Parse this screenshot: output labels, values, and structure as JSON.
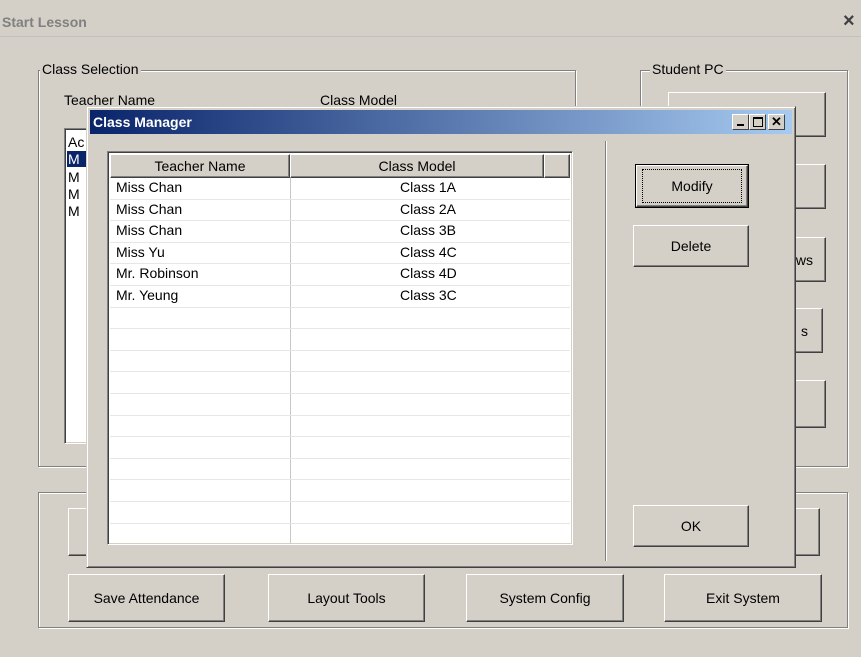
{
  "main_window": {
    "title": "Start Lesson",
    "close_glyph": "×",
    "class_selection": {
      "legend": "Class Selection",
      "col_teacher_partial": "Teacher Name",
      "col_class_partial": "Class Model",
      "list_items_partial": [
        "Ac",
        "M",
        "M",
        "M",
        "M"
      ]
    },
    "student_pc": {
      "legend": "Student PC",
      "partial_labels": [
        "",
        "",
        "ws",
        "s",
        ""
      ]
    },
    "bottom_buttons": [
      {
        "label": "Save Attendance"
      },
      {
        "label": "Layout Tools"
      },
      {
        "label": "System Config"
      },
      {
        "label": "Exit System"
      }
    ]
  },
  "dialog": {
    "title": "Class Manager",
    "columns": [
      "Teacher Name",
      "Class Model"
    ],
    "rows": [
      {
        "teacher": "Miss Chan",
        "class": "Class 1A"
      },
      {
        "teacher": "Miss Chan",
        "class": "Class 2A"
      },
      {
        "teacher": "Miss Chan",
        "class": "Class 3B"
      },
      {
        "teacher": "Miss Yu",
        "class": "Class 4C"
      },
      {
        "teacher": "Mr. Robinson",
        "class": "Class 4D"
      },
      {
        "teacher": "Mr. Yeung",
        "class": "Class 3C"
      }
    ],
    "buttons": {
      "modify": "Modify",
      "delete": "Delete",
      "ok": "OK"
    }
  }
}
